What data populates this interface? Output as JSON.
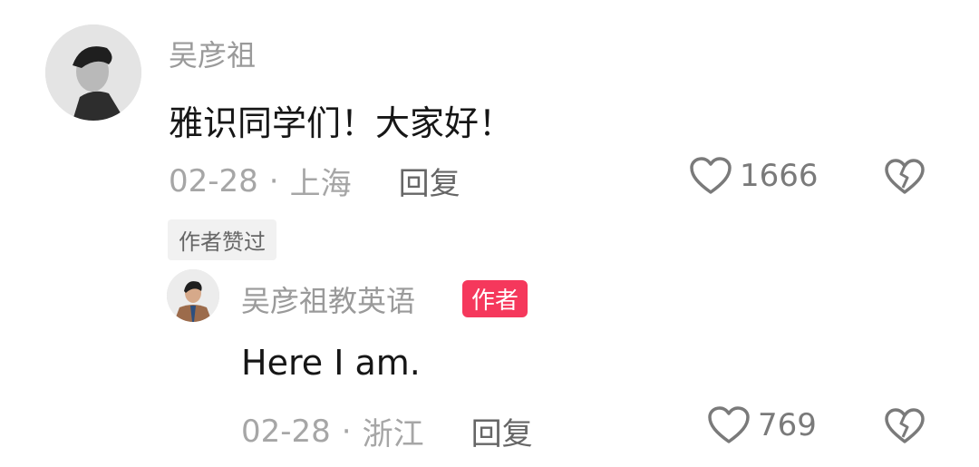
{
  "comment": {
    "username": "吴彦祖",
    "text": "雅识同学们！大家好！",
    "date": "02-28",
    "separator": "·",
    "location": "上海",
    "reply_label": "回复",
    "like_count": "1666",
    "liked_by_author_label": "作者赞过"
  },
  "reply": {
    "username": "吴彦祖教英语",
    "badge": "作者",
    "text": "Here I am.",
    "date": "02-28",
    "separator": "·",
    "location": "浙江",
    "reply_label": "回复",
    "like_count": "769"
  },
  "icons": {
    "like": "heart-outline-icon",
    "dislike": "broken-heart-icon"
  },
  "colors": {
    "author_badge": "#f5385c",
    "secondary_text": "#9a9a9a"
  }
}
